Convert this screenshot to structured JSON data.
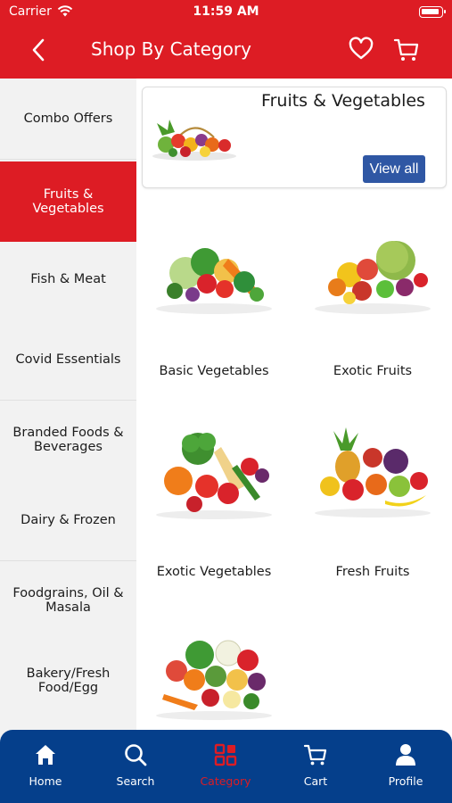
{
  "status_bar": {
    "carrier": "Carrier",
    "time": "11:59 AM"
  },
  "header": {
    "title": "Shop By Category"
  },
  "sidebar": {
    "items": [
      {
        "label": "Combo Offers"
      },
      {
        "label": "Fruits &\nVegetables",
        "active": true
      },
      {
        "label": "Fish & Meat"
      },
      {
        "label": "Covid Essentials"
      },
      {
        "label": "Branded Foods &\nBeverages"
      },
      {
        "label": "Dairy & Frozen"
      },
      {
        "label": "Foodgrains, Oil &\nMasala"
      },
      {
        "label": "Bakery/Fresh\nFood/Egg"
      }
    ]
  },
  "main": {
    "banner": {
      "title": "Fruits & Vegetables",
      "view_all_label": "View all"
    },
    "products": [
      {
        "label": "Basic Vegetables"
      },
      {
        "label": "Exotic Fruits"
      },
      {
        "label": "Exotic Vegetables"
      },
      {
        "label": "Fresh Fruits"
      },
      {
        "label": ""
      }
    ]
  },
  "tabbar": {
    "items": [
      {
        "label": "Home",
        "icon": "home-icon"
      },
      {
        "label": "Search",
        "icon": "search-icon"
      },
      {
        "label": "Category",
        "icon": "category-grid-icon",
        "active": true
      },
      {
        "label": "Cart",
        "icon": "cart-icon"
      },
      {
        "label": "Profile",
        "icon": "profile-icon"
      }
    ]
  },
  "colors": {
    "brand_red": "#dd1c24",
    "tabbar_blue": "#053f8b",
    "button_blue": "#2f57a4",
    "sidebar_gray": "#f2f2f2"
  }
}
